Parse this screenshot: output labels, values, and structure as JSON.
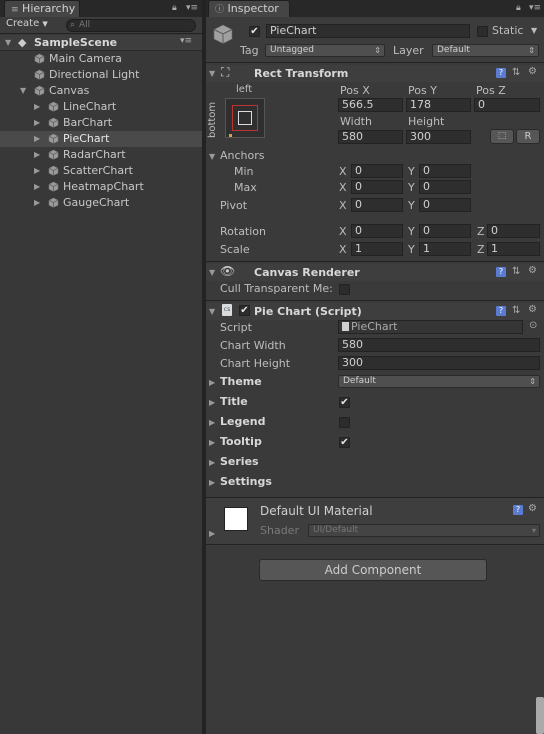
{
  "hierarchy": {
    "tab_label": "Hierarchy",
    "create_label": "Create",
    "search_placeholder": "All",
    "scene_name": "SampleScene",
    "items": [
      {
        "label": "Main Camera"
      },
      {
        "label": "Directional Light"
      },
      {
        "label": "Canvas"
      },
      {
        "label": "LineChart"
      },
      {
        "label": "BarChart"
      },
      {
        "label": "PieChart"
      },
      {
        "label": "RadarChart"
      },
      {
        "label": "ScatterChart"
      },
      {
        "label": "HeatmapChart"
      },
      {
        "label": "GaugeChart"
      }
    ]
  },
  "inspector": {
    "tab_label": "Inspector",
    "object_name": "PieChart",
    "static_label": "Static",
    "tag_label": "Tag",
    "tag_value": "Untagged",
    "layer_label": "Layer",
    "layer_value": "Default",
    "rect_transform": {
      "title": "Rect Transform",
      "anchor_h": "left",
      "anchor_v": "bottom",
      "pos_x_label": "Pos X",
      "pos_y_label": "Pos Y",
      "pos_z_label": "Pos Z",
      "pos_x": "566.5",
      "pos_y": "178",
      "pos_z": "0",
      "width_label": "Width",
      "height_label": "Height",
      "width": "580",
      "height": "300",
      "r_button": "R",
      "anchors_label": "Anchors",
      "min_label": "Min",
      "max_label": "Max",
      "min_x": "0",
      "min_y": "0",
      "max_x": "0",
      "max_y": "0",
      "pivot_label": "Pivot",
      "pivot_x": "0",
      "pivot_y": "0",
      "rotation_label": "Rotation",
      "rot_x": "0",
      "rot_y": "0",
      "rot_z": "0",
      "scale_label": "Scale",
      "scale_x": "1",
      "scale_y": "1",
      "scale_z": "1",
      "x": "X",
      "y": "Y",
      "z": "Z"
    },
    "canvas_renderer": {
      "title": "Canvas Renderer",
      "cull_label": "Cull Transparent Me:"
    },
    "pie_chart": {
      "title": "Pie Chart (Script)",
      "script_label": "Script",
      "script_value": "PieChart",
      "width_label": "Chart Width",
      "width_value": "580",
      "height_label": "Chart Height",
      "height_value": "300",
      "theme_label": "Theme",
      "theme_value": "Default",
      "title_label": "Title",
      "legend_label": "Legend",
      "tooltip_label": "Tooltip",
      "series_label": "Series",
      "settings_label": "Settings",
      "title_checked": true,
      "legend_checked": false,
      "tooltip_checked": true
    },
    "material": {
      "name": "Default UI Material",
      "shader_label": "Shader",
      "shader_value": "UI/Default"
    },
    "add_component_label": "Add Component"
  }
}
